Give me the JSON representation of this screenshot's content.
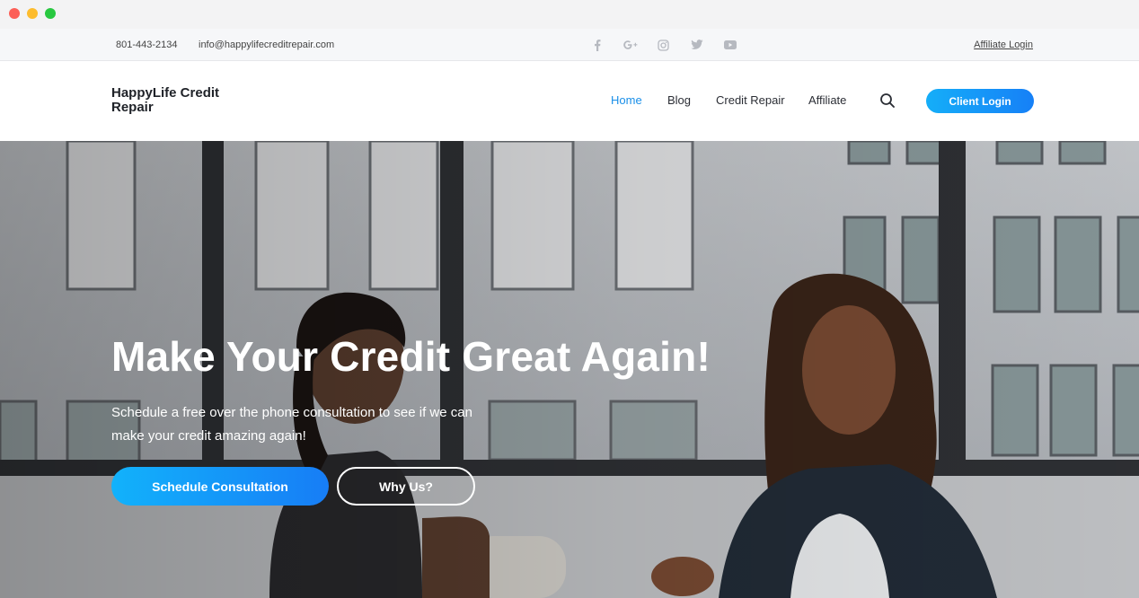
{
  "topbar": {
    "phone": "801-443-2134",
    "email": "info@happylifecreditrepair.com",
    "social_icons": [
      "facebook-icon",
      "google-plus-icon",
      "instagram-icon",
      "twitter-icon",
      "youtube-icon"
    ],
    "affiliate_login": "Affiliate Login"
  },
  "header": {
    "logo": "HappyLife Credit Repair",
    "nav": [
      {
        "label": "Home",
        "active": true
      },
      {
        "label": "Blog",
        "active": false
      },
      {
        "label": "Credit Repair",
        "active": false
      },
      {
        "label": "Affiliate",
        "active": false
      }
    ],
    "search_icon": "search-icon",
    "client_login": "Client Login"
  },
  "hero": {
    "title": "Make Your Credit Great Again!",
    "subtitle": "Schedule a free over the phone consultation to see if we can make your credit amazing again!",
    "primary_button": "Schedule Consultation",
    "secondary_button": "Why Us?"
  },
  "colors": {
    "accent": "#1a8fe8",
    "button_gradient_start": "#12b2fb",
    "button_gradient_end": "#177df6"
  }
}
